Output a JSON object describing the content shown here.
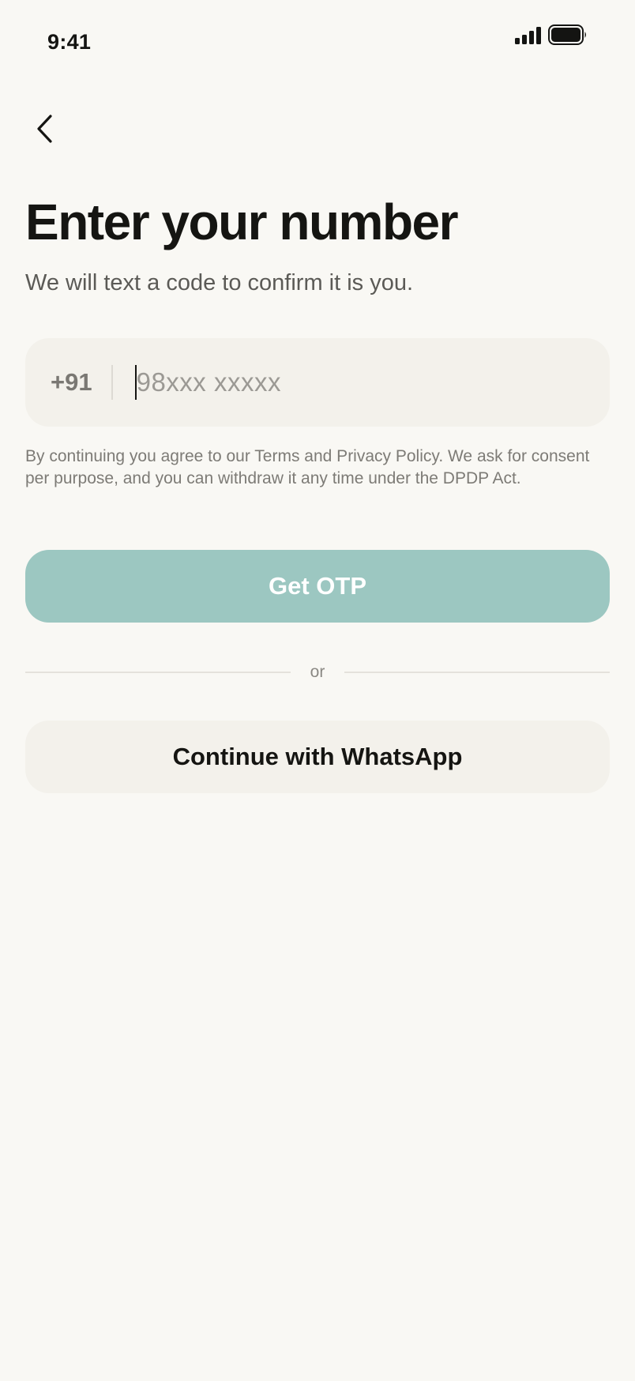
{
  "status_bar": {
    "time": "9:41",
    "signal_icon": "cellular-signal-icon",
    "battery_icon": "battery-icon"
  },
  "nav": {
    "back_icon": "chevron-left-icon"
  },
  "header": {
    "title": "Enter your number",
    "subtitle": "We will text a code to confirm it is you."
  },
  "phone": {
    "country_code": "+91",
    "value": "",
    "placeholder": "98xxx xxxxx"
  },
  "consent_text": "By continuing you agree to our Terms and Privacy Policy. We ask for consent per purpose, and you can withdraw it any time under the DPDP Act.",
  "actions": {
    "primary_label": "Get OTP",
    "divider_label": "or",
    "secondary_label": "Continue with WhatsApp"
  },
  "colors": {
    "background": "#F9F8F4",
    "field": "#F3F1EB",
    "accent": "#9CC7C1",
    "text": "#151512"
  }
}
